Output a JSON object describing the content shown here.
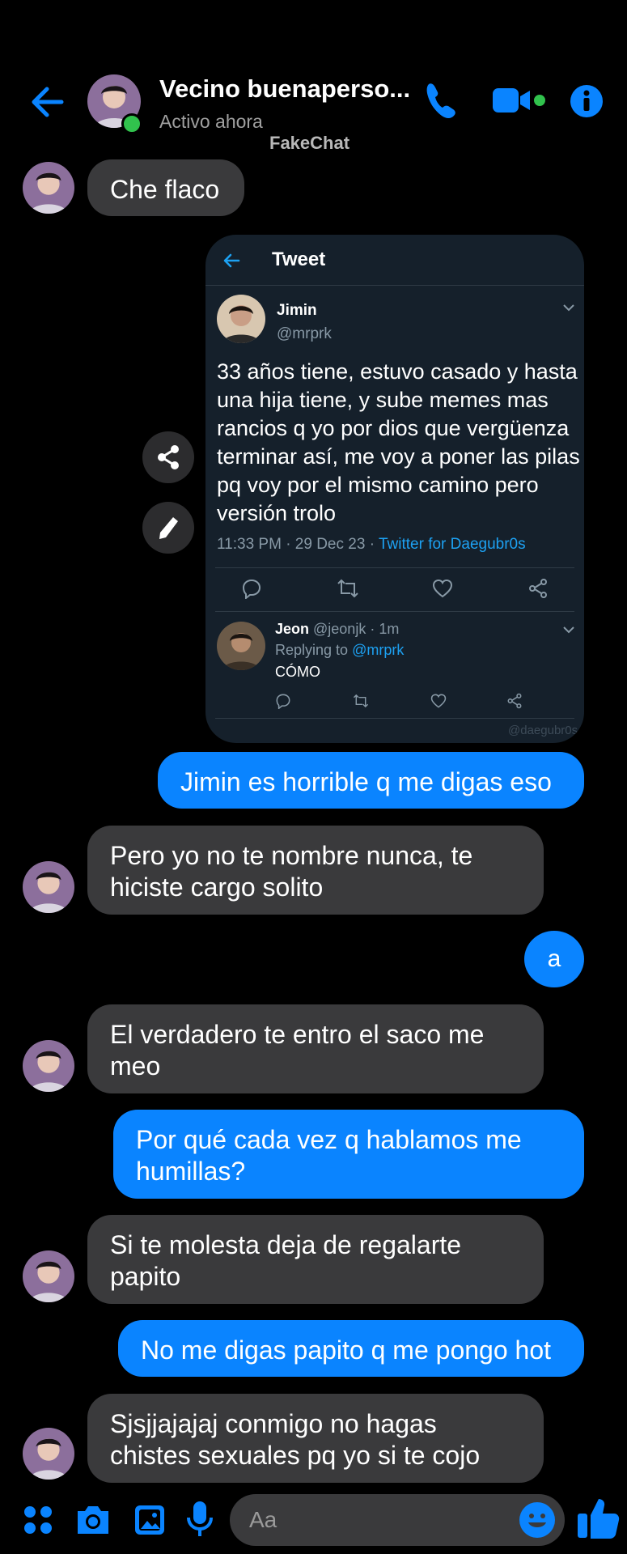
{
  "header": {
    "contact_name": "Vecino buenaperso...",
    "status": "Activo ahora",
    "watermark": "FakeChat"
  },
  "colors": {
    "accent": "#0a84ff",
    "received_bubble": "#3a3a3c",
    "online": "#31c24d",
    "tweet_bg": "#15202b"
  },
  "tweet": {
    "header_title": "Tweet",
    "author_name": "Jimin",
    "author_handle": "@mrprk",
    "text": "33 años tiene, estuvo casado y hasta una hija tiene, y sube memes mas rancios q yo por dios que vergüenza terminar así, me voy a poner las pilas pq voy por el mismo camino pero versión trolo",
    "timestamp": "11:33 PM · 29 Dec 23 · ",
    "source": "Twitter for Daegubr0s",
    "reply": {
      "author_name": "Jeon",
      "handle_time": " @jeonjk · 1m",
      "replying_prefix": "Replying to ",
      "replying_handle": "@mrprk",
      "text": "CÓMO"
    },
    "watermark": "@daegubr0s"
  },
  "messages": {
    "m1": "Che flaco",
    "m2": "Jimin es horrible q me digas eso",
    "m3": "Pero yo no te nombre nunca, te hiciste cargo solito",
    "m4": "a",
    "m5": "El verdadero te entro el saco me meo",
    "m6": "Por qué cada vez q hablamos me humillas?",
    "m7": "Si te molesta deja de regalarte papito",
    "m8": "No me digas papito q me pongo hot",
    "m9": "Sjsjjajajaj conmigo no hagas chistes sexuales pq yo si te cojo"
  },
  "composer": {
    "placeholder": "Aa"
  },
  "icons": [
    "back-arrow-icon",
    "phone-icon",
    "video-camera-icon",
    "info-icon",
    "share-icon",
    "pencil-icon",
    "reply-icon",
    "retweet-icon",
    "heart-icon",
    "share-tweet-icon",
    "menu-dots-icon",
    "camera-icon",
    "gallery-icon",
    "microphone-icon",
    "emoji-icon",
    "thumbs-up-icon"
  ]
}
